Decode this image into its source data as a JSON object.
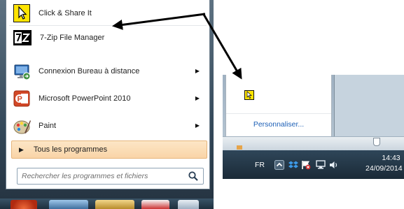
{
  "start_menu": {
    "items": [
      {
        "label": "Click & Share It",
        "icon": "cursor-app-icon",
        "has_submenu": false
      },
      {
        "label": "7-Zip File Manager",
        "icon": "7zip-icon",
        "has_submenu": false
      },
      {
        "label": "Connexion Bureau à distance",
        "icon": "remote-desktop-icon",
        "has_submenu": true
      },
      {
        "label": "Microsoft PowerPoint 2010",
        "icon": "powerpoint-icon",
        "has_submenu": true
      },
      {
        "label": "Paint",
        "icon": "paint-icon",
        "has_submenu": true
      }
    ],
    "all_programs_label": "Tous les programmes",
    "search_placeholder": "Rechercher les programmes et fichiers"
  },
  "tray": {
    "popup_link": "Personnaliser...",
    "language": "FR",
    "time": "14:43",
    "date": "24/09/2014"
  },
  "colors": {
    "highlight_orange": "#fbe0bd",
    "link_blue": "#1c5fb6",
    "taskbar": "#1d2f3d",
    "arrow": "#000000"
  }
}
